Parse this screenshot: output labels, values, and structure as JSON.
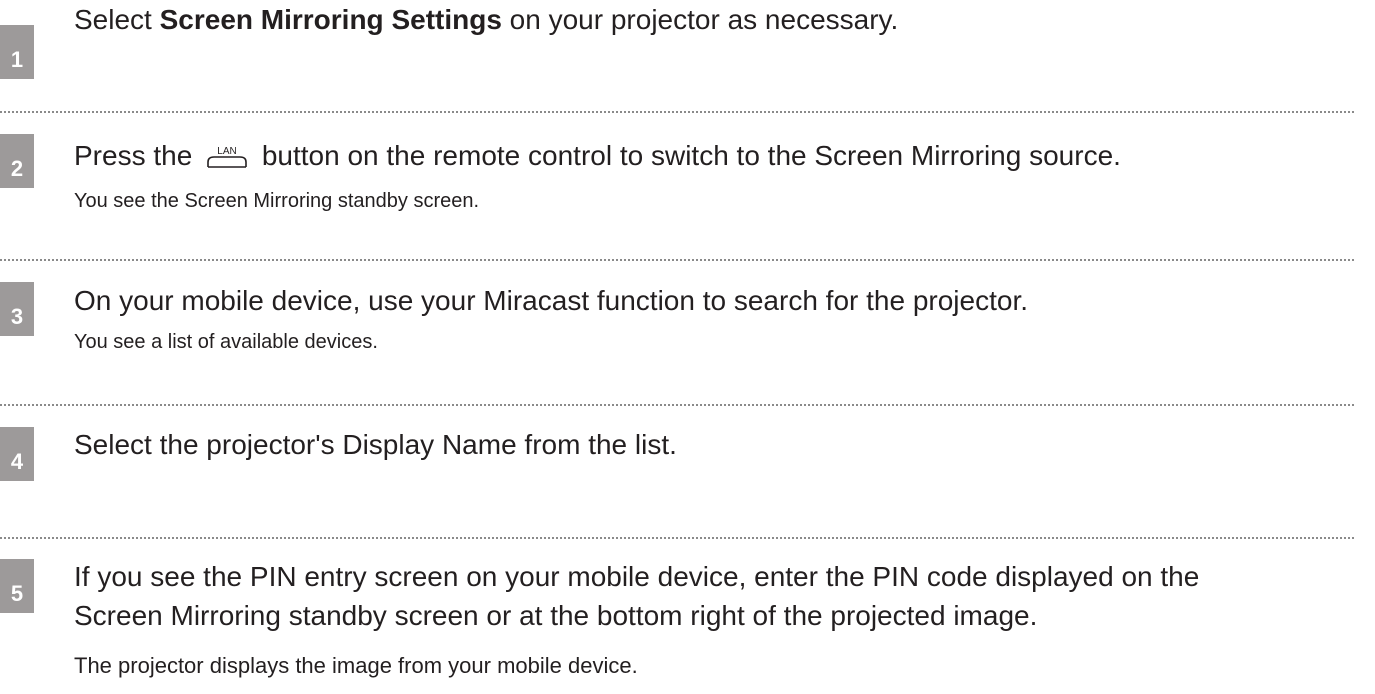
{
  "steps": [
    {
      "number": "1",
      "text_before": "Select ",
      "text_bold": "Screen Mirroring Settings",
      "text_after": " on your projector as necessary."
    },
    {
      "number": "2",
      "text_before": "Press the ",
      "button_label": "LAN",
      "text_after": " button on the remote control to switch to the Screen Mirroring source.",
      "result": "You see the Screen Mirroring standby screen."
    },
    {
      "number": "3",
      "text": "On your mobile device, use your Miracast function to search for the projector.",
      "result": "You see a list of available devices."
    },
    {
      "number": "4",
      "text": "Select the projector's Display Name from the list."
    },
    {
      "number": "5",
      "text_line1": "If you see the PIN entry screen on your mobile device, enter the PIN code displayed on the",
      "text_line2": "Screen Mirroring standby screen or at the bottom right of the projected image.",
      "result": "The projector displays the image from your mobile device."
    }
  ],
  "colors": {
    "badge": "#9d9a9a",
    "text": "#231f20",
    "divider": "#8a8a8a"
  },
  "icons": {
    "lan_button": "lan-remote-button-icon"
  }
}
